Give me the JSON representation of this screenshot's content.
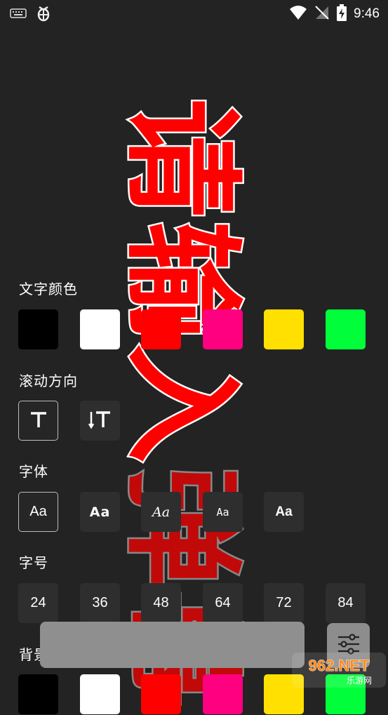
{
  "status_bar": {
    "time": "9:46",
    "left_icons": [
      "keyboard-icon",
      "bug-icon"
    ],
    "right_icons": [
      "wifi-icon",
      "no-signal-icon",
      "battery-charging-icon"
    ]
  },
  "marquee": {
    "text": "请输入弹幕",
    "color": "#ff0000"
  },
  "sections": {
    "text_color": {
      "label": "文字颜色",
      "colors": [
        "#000000",
        "#ffffff",
        "#ff0000",
        "#ff0080",
        "#ffe000",
        "#00ff3a"
      ]
    },
    "scroll_direction": {
      "label": "滚动方向",
      "options": [
        "horizontal-text-icon",
        "vertical-text-icon"
      ],
      "selected": 0
    },
    "font": {
      "label": "字体",
      "options": [
        "Aa",
        "Aa",
        "Aa",
        "Aa",
        "Aa"
      ],
      "selected": 0
    },
    "font_size": {
      "label": "字号",
      "options": [
        "24",
        "36",
        "48",
        "64",
        "72",
        "84"
      ]
    },
    "background_color": {
      "label": "背景颜色",
      "colors": [
        "#000000",
        "#ffffff",
        "#ff0000",
        "#ff0080",
        "#ffe000",
        "#00ff3a"
      ]
    }
  },
  "watermark": {
    "brand": "962.NET",
    "sub": "乐游网"
  }
}
